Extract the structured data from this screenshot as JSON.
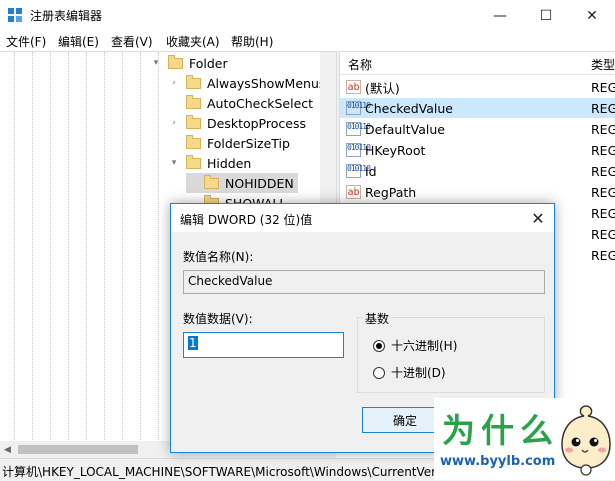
{
  "window": {
    "title": "注册表编辑器",
    "minimize": "—",
    "maximize": "☐",
    "close": "✕"
  },
  "menu": [
    "文件(F)",
    "编辑(E)",
    "查看(V)",
    "收藏夹(A)",
    "帮助(H)"
  ],
  "tree": {
    "items": [
      {
        "label": "Folder",
        "arrow": "▾"
      },
      {
        "label": "AlwaysShowMenus",
        "arrow": "›"
      },
      {
        "label": "AutoCheckSelect",
        "arrow": ""
      },
      {
        "label": "DesktopProcess",
        "arrow": "›"
      },
      {
        "label": "FolderSizeTip",
        "arrow": ""
      },
      {
        "label": "Hidden",
        "arrow": "▾"
      },
      {
        "label": "NOHIDDEN",
        "arrow": ""
      },
      {
        "label": "SHOWALL",
        "arrow": ""
      }
    ]
  },
  "list": {
    "headers": {
      "name": "名称",
      "type": "类型"
    },
    "rows": [
      {
        "name": "(默认)",
        "type": "REG",
        "icon": "ab"
      },
      {
        "name": "CheckedValue",
        "type": "REG",
        "icon": "bin"
      },
      {
        "name": "DefaultValue",
        "type": "REG",
        "icon": "bin"
      },
      {
        "name": "HKeyRoot",
        "type": "REG",
        "icon": "bin"
      },
      {
        "name": "Id",
        "type": "REG",
        "icon": "bin"
      },
      {
        "name": "RegPath",
        "type": "REG",
        "icon": "ab"
      },
      {
        "name": "",
        "type": "REG",
        "icon": ""
      },
      {
        "name": "",
        "type": "REG",
        "icon": ""
      },
      {
        "name": "",
        "type": "REG",
        "icon": ""
      }
    ],
    "icon_text": {
      "ab": "ab",
      "bin": "010110"
    }
  },
  "status": "计算机\\HKEY_LOCAL_MACHINE\\SOFTWARE\\Microsoft\\Windows\\CurrentVer",
  "dialog": {
    "title": "编辑 DWORD (32 位)值",
    "close": "✕",
    "name_label": "数值名称(N):",
    "name_value": "CheckedValue",
    "data_label": "数值数据(V):",
    "data_value": "1",
    "base_label": "基数",
    "hex_label": "十六进制(H)",
    "dec_label": "十进制(D)",
    "ok_label": "确定"
  },
  "watermark": {
    "text": "为什么",
    "url": "www.byylb.com"
  },
  "colors": {
    "selection": "#cce8ff",
    "dialog_border": "#1883d7",
    "watermark_green": "#2aa24a",
    "watermark_blue": "#1b62b5"
  }
}
